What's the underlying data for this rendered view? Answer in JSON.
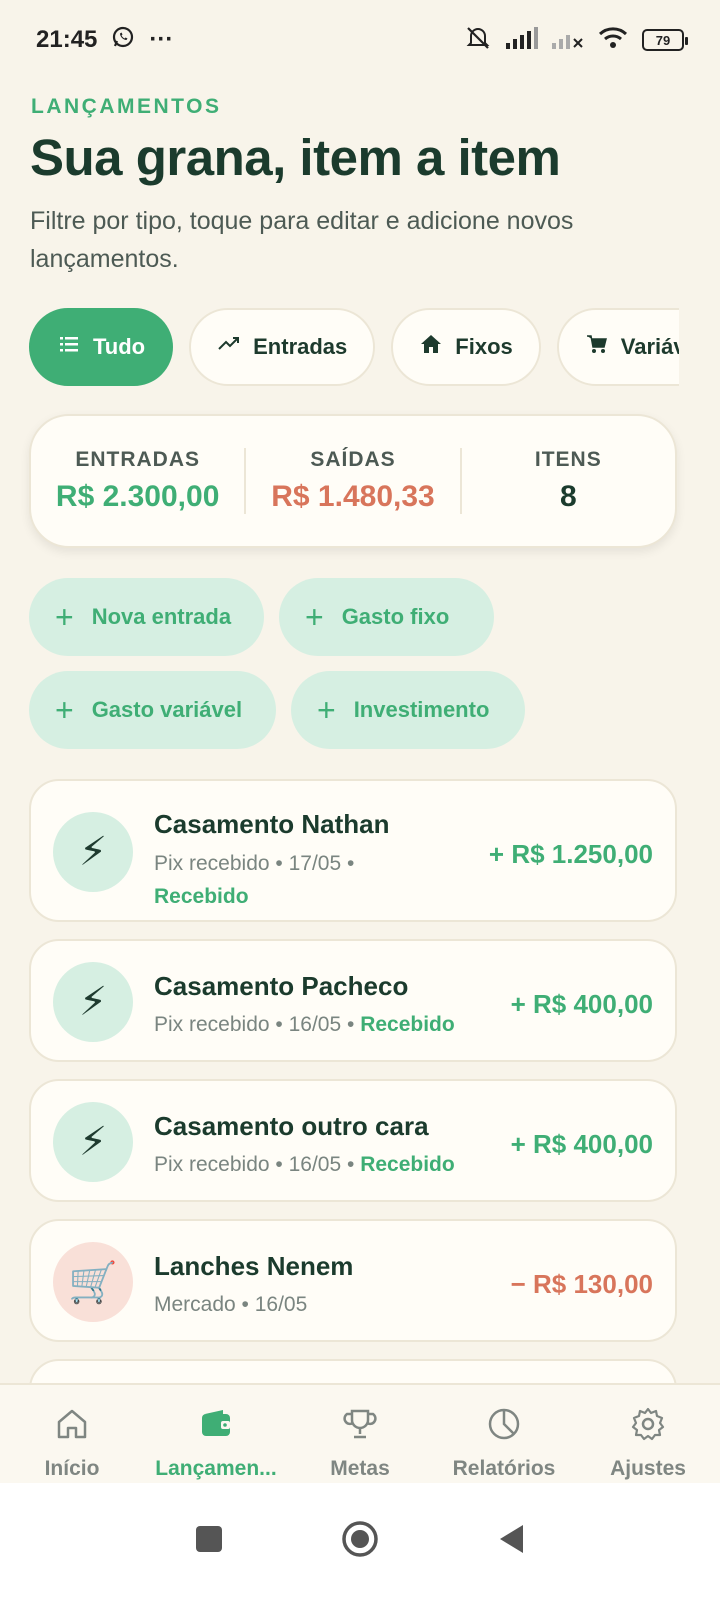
{
  "status_bar": {
    "time": "21:45",
    "more": "···",
    "battery": "79"
  },
  "header": {
    "eyebrow": "LANÇAMENTOS",
    "title": "Sua grana, item a item",
    "subtitle": "Filtre por tipo, toque para editar e adicione novos lançamentos."
  },
  "filters": [
    {
      "label": "Tudo",
      "icon": "list-icon",
      "active": true
    },
    {
      "label": "Entradas",
      "icon": "trend-up-icon",
      "active": false
    },
    {
      "label": "Fixos",
      "icon": "home-icon",
      "active": false
    },
    {
      "label": "Variáveis",
      "icon": "cart-icon",
      "active": false
    }
  ],
  "summary": {
    "income_label": "ENTRADAS",
    "income_value": "R$ 2.300,00",
    "expense_label": "SAÍDAS",
    "expense_value": "R$ 1.480,33",
    "items_label": "ITENS",
    "items_value": "8"
  },
  "quick_actions": [
    {
      "label": "Nova entrada"
    },
    {
      "label": "Gasto fixo"
    },
    {
      "label": "Gasto variável"
    },
    {
      "label": "Investimento"
    }
  ],
  "transactions": [
    {
      "name": "Casamento Nathan",
      "category": "Pix recebido",
      "date": "17/05",
      "status": "Recebido",
      "amount": "+ R$ 1.250,00",
      "icon": "lightning-icon"
    },
    {
      "name": "Casamento Pacheco",
      "category": "Pix recebido",
      "date": "16/05",
      "status": "Recebido",
      "amount": "+ R$ 400,00",
      "icon": "lightning-icon"
    },
    {
      "name": "Casamento outro cara",
      "category": "Pix recebido",
      "date": "16/05",
      "status": "Recebido",
      "amount": "+ R$ 400,00",
      "icon": "lightning-icon"
    },
    {
      "name": "Lanches Nenem",
      "category": "Mercado",
      "date": "16/05",
      "status": "",
      "amount": "− R$ 130,00",
      "icon": "shopping-cart-icon"
    }
  ],
  "bottom_nav": [
    {
      "label": "Início",
      "icon": "home-icon"
    },
    {
      "label": "Lançamen...",
      "icon": "wallet-icon",
      "active": true
    },
    {
      "label": "Metas",
      "icon": "trophy-icon"
    },
    {
      "label": "Relatórios",
      "icon": "pie-chart-icon"
    },
    {
      "label": "Ajustes",
      "icon": "gear-icon"
    }
  ],
  "colors": {
    "accent": "#3fae75",
    "expense": "#d8755b",
    "background": "#f8f4ea",
    "text": "#1b3b2d"
  }
}
